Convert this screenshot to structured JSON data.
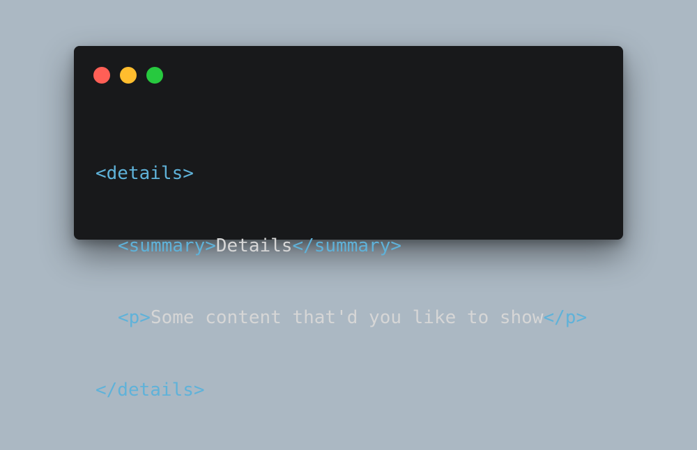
{
  "colors": {
    "background": "#abb8c3",
    "window": "#18191b",
    "tag": "#5fb2d9",
    "text": "#d6d6d6"
  },
  "window_controls": [
    {
      "name": "close-dot",
      "color": "#ff5f56"
    },
    {
      "name": "minimize-dot",
      "color": "#ffbd2e"
    },
    {
      "name": "maximize-dot",
      "color": "#27c93f"
    }
  ],
  "code": {
    "line1": {
      "tag": "<details>"
    },
    "line2": {
      "open_tag": "<summary>",
      "text": "Details",
      "close_tag": "</summary>"
    },
    "line3": {
      "open_tag": "<p>",
      "text": "Some content that'd you like to show",
      "close_tag": "</p>"
    },
    "line4": {
      "tag": "</details>"
    }
  }
}
